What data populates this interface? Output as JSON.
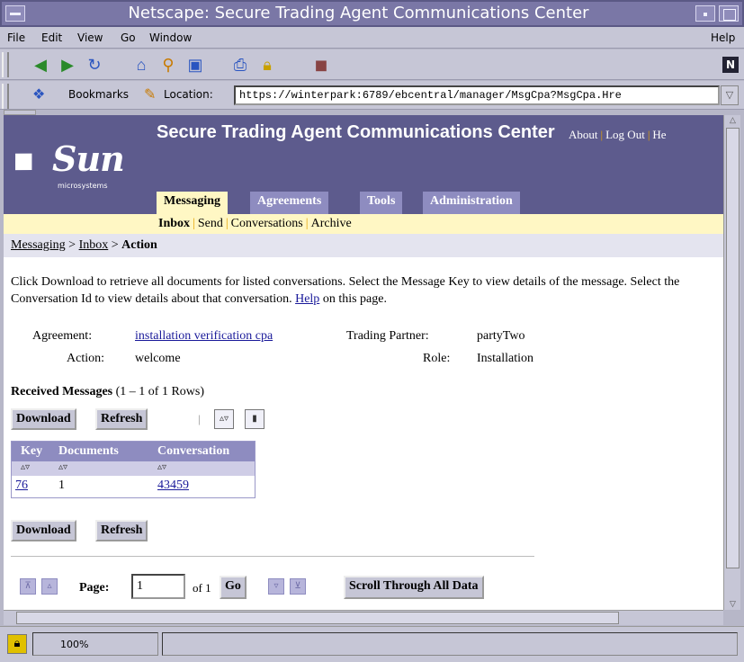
{
  "window": {
    "title": "Netscape: Secure Trading Agent Communications Center"
  },
  "menu": {
    "file": "File",
    "edit": "Edit",
    "view": "View",
    "go": "Go",
    "window": "Window",
    "help": "Help"
  },
  "location": {
    "bookmarks_label": "Bookmarks",
    "location_label": "Location:",
    "url": "https://winterpark:6789/ebcentral/manager/MsgCpa?MsgCpa.Hre"
  },
  "header": {
    "logo_word": "Sun",
    "logo_sub": "microsystems",
    "app_title": "Secure Trading Agent Communications Center",
    "links": [
      "About",
      "Log Out",
      "He"
    ]
  },
  "tabs": [
    "Messaging",
    "Agreements",
    "Tools",
    "Administration"
  ],
  "subnav": [
    "Inbox",
    "Send",
    "Conversations",
    "Archive"
  ],
  "breadcrumb": {
    "messaging": "Messaging",
    "sep1": ">",
    "inbox": "Inbox",
    "sep2": ">",
    "current": "Action"
  },
  "intro": {
    "text": "Click Download to retrieve all documents for listed conversations. Select the Message Key to view details of the message. Select the Conversation Id to view details about that conversation.",
    "help_link": "Help",
    "help_suffix": "on this page."
  },
  "details": {
    "agreement_label": "Agreement:",
    "agreement_value": "installation verification cpa",
    "partner_label": "Trading Partner:",
    "partner_value": "partyTwo",
    "action_label": "Action:",
    "action_value": "welcome",
    "role_label": "Role:",
    "role_value": "Installation"
  },
  "received": {
    "title": "Received Messages",
    "count": "(1 – 1 of 1 Rows)"
  },
  "buttons": {
    "download": "Download",
    "refresh": "Refresh",
    "sep": "|",
    "go": "Go",
    "scroll_all": "Scroll Through All Data"
  },
  "table": {
    "headers": [
      "Key",
      "Documents",
      "Conversation"
    ],
    "sort_glyph": "▵▿",
    "rows": [
      {
        "key": "76",
        "documents": "1",
        "conversation": "43459"
      }
    ]
  },
  "pager": {
    "label": "Page:",
    "value": "1",
    "of": "of 1"
  },
  "status": {
    "zoom": "100%"
  },
  "colors": {
    "header_bg": "#5d5b8d",
    "tab_bg": "#8e8cc0",
    "subnav_bg": "#fff7c4",
    "link": "#1a1a9a"
  }
}
